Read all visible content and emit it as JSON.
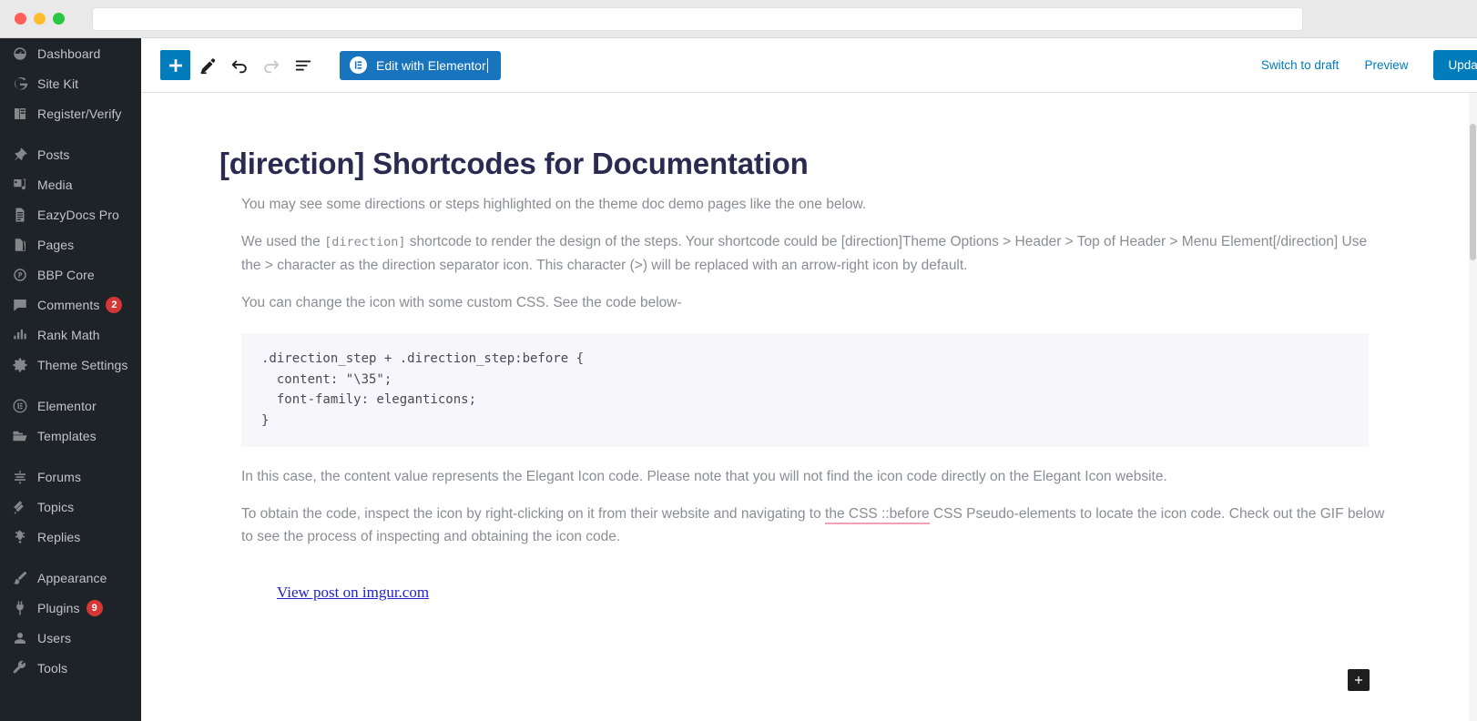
{
  "browser": {
    "url_value": "",
    "url_placeholder": "",
    "traffic_lights": [
      "close",
      "minimize",
      "maximize"
    ]
  },
  "sidebar": {
    "items": [
      {
        "label": "Dashboard",
        "icon": "dashboard-icon",
        "badge": null
      },
      {
        "label": "Site Kit",
        "icon": "google-g-icon",
        "badge": null
      },
      {
        "label": "Register/Verify",
        "icon": "book-icon",
        "badge": null
      },
      {
        "separator_after": true,
        "label": "Posts",
        "icon": "pin-icon",
        "badge": null
      },
      {
        "label": "Media",
        "icon": "media-icon",
        "badge": null
      },
      {
        "label": "EazyDocs Pro",
        "icon": "document-icon",
        "badge": null
      },
      {
        "label": "Pages",
        "icon": "pages-icon",
        "badge": null
      },
      {
        "label": "BBP Core",
        "icon": "bbp-core-icon",
        "badge": null
      },
      {
        "label": "Comments",
        "icon": "comment-icon",
        "badge": "2"
      },
      {
        "label": "Rank Math",
        "icon": "rank-math-icon",
        "badge": null
      },
      {
        "label": "Theme Settings",
        "icon": "gear-icon",
        "badge": null
      },
      {
        "label": "Elementor",
        "icon": "elementor-icon",
        "badge": null
      },
      {
        "label": "Templates",
        "icon": "folder-icon",
        "badge": null
      },
      {
        "label": "Forums",
        "icon": "forums-icon",
        "badge": null
      },
      {
        "label": "Topics",
        "icon": "topics-icon",
        "badge": null
      },
      {
        "label": "Replies",
        "icon": "replies-icon",
        "badge": null
      },
      {
        "label": "Appearance",
        "icon": "brush-icon",
        "badge": null
      },
      {
        "label": "Plugins",
        "icon": "plug-icon",
        "badge": "9"
      },
      {
        "label": "Users",
        "icon": "user-icon",
        "badge": null
      },
      {
        "label": "Tools",
        "icon": "wrench-icon",
        "badge": null
      }
    ]
  },
  "header": {
    "add_block_label": "+",
    "tools": [
      {
        "name": "add-block",
        "icon": "plus-icon"
      },
      {
        "name": "edit-mode",
        "icon": "pencil-icon"
      },
      {
        "name": "undo",
        "icon": "undo-icon"
      },
      {
        "name": "redo",
        "icon": "redo-icon"
      },
      {
        "name": "list-view",
        "icon": "list-view-icon"
      }
    ],
    "elementor_button": "Edit with Elementor",
    "switch_to_draft": "Switch to draft",
    "preview": "Preview",
    "update": "Update"
  },
  "post": {
    "title": "[direction] Shortcodes for Documentation",
    "paragraph_1": "You may see some directions or steps highlighted on the theme doc demo pages like the one below.",
    "paragraph_2": {
      "part_1": "We used the ",
      "code_1": "[direction]",
      "part_2": " shortcode to render the design of the steps. Your shortcode could be [direction]Theme Options > Header > Top of Header > Menu Element[/direction]  Use the > character as the direction separator icon. This character (>) will be replaced with an arrow-right icon by default."
    },
    "paragraph_3": "You can change the icon with some custom CSS. See the code below-",
    "code_block": ".direction_step + .direction_step:before {\n  content: \"\\35\";\n  font-family: eleganticons;\n}",
    "paragraph_4": "In this case, the content value represents the Elegant Icon code. Please note that you will not find the icon code directly on the Elegant Icon website.",
    "paragraph_5": {
      "part_1": "To obtain the code, inspect the icon by right-clicking on it from their website and navigating to ",
      "underlined": "the CSS ::before",
      "part_2": " CSS Pseudo-elements to locate the icon code. Check out the GIF below to see the process of inspecting and obtaining the icon code."
    },
    "imgur_link": "View post on imgur.com"
  },
  "colors": {
    "sidebar_bg": "#1d2327",
    "accent_blue": "#007cba",
    "elementor_blue": "#1774bd",
    "badge_red": "#d63638",
    "title_navy": "#2b2b52",
    "body_gray": "#8c8c96",
    "code_bg": "#f7f6fa",
    "pink_underline": "#f4a0b5",
    "link_blue": "#2222cc"
  }
}
